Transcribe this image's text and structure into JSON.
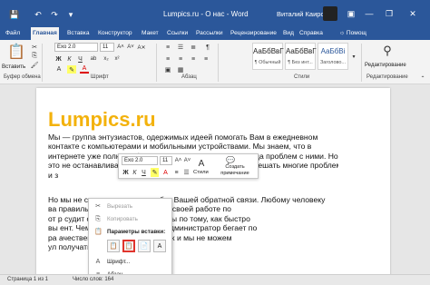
{
  "titlebar": {
    "title": "Lumpics.ru - О нас - Word",
    "user": "Виталий Каиров",
    "qa_icons": [
      "save-icon",
      "undo-icon",
      "redo-icon",
      "customize-icon"
    ],
    "qa_glyphs": [
      "💾",
      "↶",
      "↷",
      "▾"
    ],
    "ribbon_display_glyph": "▣",
    "minimize_glyph": "—",
    "restore_glyph": "❐",
    "close_glyph": "✕"
  },
  "tabs": [
    "Файл",
    "Главная",
    "Вставка",
    "Конструктор",
    "Макет",
    "Ссылки",
    "Рассылки",
    "Рецензирование",
    "Вид",
    "Справка"
  ],
  "tell_me": "Помощ",
  "ribbon": {
    "paste_label": "Вставить",
    "font_name": "Exo 2.0",
    "font_size": "11",
    "styles": [
      {
        "sample": "АаБбВвГ",
        "name": "¶ Обычный"
      },
      {
        "sample": "АаБбВвГ",
        "name": "¶ Без инт..."
      },
      {
        "sample": "АаБбВі",
        "name": "Заголово..."
      }
    ],
    "groups": {
      "clipboard": "Буфер обмена",
      "font": "Шрифт",
      "paragraph": "Абзац",
      "styles": "Стили",
      "editing": "Редактирование"
    },
    "editing_label": "Редактирование",
    "styles_label": "Стили",
    "format_buttons": [
      "Ж",
      "К",
      "Ч"
    ],
    "grow_font": "A˄",
    "shrink_font": "A˅",
    "clear_format_glyph": "A✕",
    "para_glyphs": [
      "≡",
      "☰",
      "≣",
      "¶"
    ],
    "font_color_glyph": "A"
  },
  "document": {
    "heading": "Lumpics.ru",
    "para1": [
      "Мы — группа энтузиастов, одержимых идеей помогать Вам в ежедневном",
      "контакте с компьютерами и мобильными устройствами. Мы знаем, что в",
      "интернете уже полно информации о решении разного рода проблем с ними. Но",
      "это не останавливает нас, чтобы рассказывать Вам, как решать многие проблемы",
      "и з"
    ],
    "para2": [
      "Но мы не сможем это сделать без Вашей обратной связи. Любому человеку",
      "ва                    правильные. Писатель судит о своей работе по",
      "от                   р судит о качестве своей работы по тому, как быстро",
      "вы                  ент. Чем меньше системный администратор бегает по",
      "ра                  ачественнее делает работу. Так и мы не можем",
      "ул                  получать ответов от Вас."
    ]
  },
  "mini_toolbar": {
    "font_name": "Exo 2.0",
    "font_size": "11",
    "grow_font": "A˄",
    "shrink_font": "A˅",
    "format_buttons": [
      "Ж",
      "К",
      "Ч"
    ],
    "highlight_glyph": "✎",
    "font_color_glyph": "A",
    "bullets_glyph": "≡",
    "numbering_glyph": "☰",
    "styles": "Стили",
    "new_comment": "Создать примечание",
    "comment_glyph": "💬"
  },
  "context_menu": {
    "items": [
      {
        "label": "Вырезать",
        "icon": "✂",
        "enabled": false
      },
      {
        "label": "Копировать",
        "icon": "⎘",
        "enabled": false
      },
      {
        "label": "Параметры вставки:",
        "icon": "📋",
        "enabled": true
      },
      {
        "label": "Шрифт...",
        "icon": "A",
        "enabled": true
      },
      {
        "label": "Абзац...",
        "icon": "≡",
        "enabled": true
      }
    ],
    "paste_options": [
      "📋",
      "📋",
      "📄",
      "A"
    ],
    "cut_glyph": "✂"
  },
  "statusbar": {
    "page": "Страница 1 из 1",
    "words": "Число слов: 164"
  },
  "colors": {
    "word_blue": "#2b579a",
    "heading_yellow": "#f3b20c",
    "paste_highlight": "#e0342c"
  }
}
